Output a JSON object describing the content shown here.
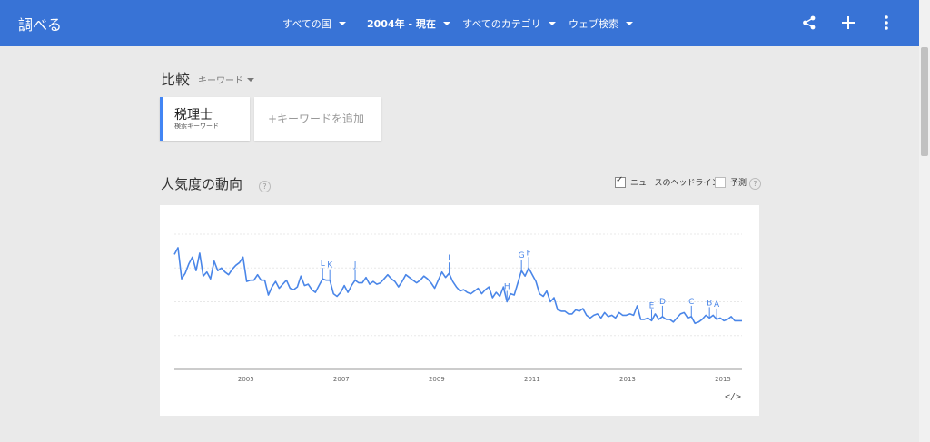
{
  "header": {
    "brand": "調べる",
    "filters": [
      {
        "label": "すべての国",
        "bold": false
      },
      {
        "label": "2004年 - 現在",
        "bold": true
      },
      {
        "label": "すべてのカテゴリ",
        "bold": false
      },
      {
        "label": "ウェブ検索",
        "bold": false
      }
    ],
    "icons": [
      "share-icon",
      "plus-icon",
      "more-vert-icon"
    ]
  },
  "compare": {
    "title": "比較",
    "type_label": "キーワード",
    "keyword": {
      "name": "税理士",
      "sub": "検索キーワード"
    },
    "add_placeholder": "+キーワードを追加"
  },
  "trend": {
    "title": "人気度の動向",
    "help": "?",
    "news_headlines": {
      "label": "ニュースのヘッドライン",
      "checked": true
    },
    "forecast": {
      "label": "予測",
      "checked": false
    },
    "embed_label": "</>"
  },
  "chart_data": {
    "type": "line",
    "series_color": "#4a86e8",
    "x_start": 2004.0,
    "x_end": 2015.9,
    "xticks": [
      2005,
      2007,
      2009,
      2011,
      2013,
      2015
    ],
    "ylim": [
      0,
      100
    ],
    "y": [
      85,
      90,
      67,
      71,
      78,
      83,
      73,
      86,
      69,
      72,
      67,
      80,
      73,
      75,
      72,
      70,
      74,
      77,
      79,
      83,
      65,
      66,
      66,
      70,
      66,
      66,
      55,
      61,
      65,
      60,
      63,
      66,
      60,
      59,
      61,
      69,
      62,
      63,
      59,
      57,
      62,
      67,
      66,
      66,
      56,
      54,
      57,
      62,
      57,
      62,
      66,
      64,
      64,
      68,
      63,
      65,
      63,
      64,
      67,
      70,
      67,
      65,
      61,
      65,
      70,
      68,
      66,
      64,
      66,
      69,
      67,
      64,
      60,
      66,
      72,
      68,
      71,
      65,
      61,
      58,
      59,
      57,
      56,
      58,
      60,
      56,
      59,
      61,
      53,
      57,
      54,
      61,
      50,
      56,
      55,
      64,
      73,
      69,
      75,
      70,
      65,
      56,
      54,
      58,
      50,
      53,
      44,
      43,
      43,
      41,
      41,
      44,
      43,
      45,
      40,
      38,
      40,
      41,
      38,
      42,
      39,
      40,
      38,
      42,
      40,
      40,
      41,
      40,
      47,
      37,
      37,
      38,
      36,
      41,
      37,
      39,
      37,
      37,
      35,
      38,
      41,
      42,
      38,
      39,
      34,
      35,
      37,
      40,
      38,
      40,
      37,
      38,
      36,
      37,
      39,
      36,
      36,
      36
    ],
    "annotations": [
      "L",
      "K",
      "J",
      "I",
      "H",
      "G",
      "F",
      "E",
      "D",
      "C",
      "B",
      "A"
    ]
  }
}
